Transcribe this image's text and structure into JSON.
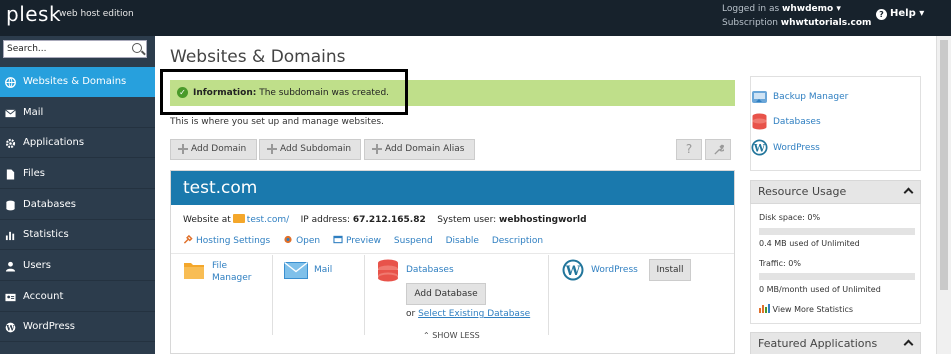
{
  "header": {
    "logo": "plesk",
    "edition": "web host edition",
    "logged_in_label": "Logged in as",
    "user": "whwdemo",
    "subscription_label": "Subscription",
    "subscription": "whwtutorials.com",
    "help": "Help"
  },
  "search": {
    "placeholder": "Search..."
  },
  "sidebar": {
    "items": [
      {
        "label": "Websites & Domains",
        "icon": "globe-icon",
        "active": true
      },
      {
        "label": "Mail",
        "icon": "envelope-icon"
      },
      {
        "label": "Applications",
        "icon": "gear-icon"
      },
      {
        "label": "Files",
        "icon": "file-icon"
      },
      {
        "label": "Databases",
        "icon": "database-icon"
      },
      {
        "label": "Statistics",
        "icon": "bar-chart-icon"
      },
      {
        "label": "Users",
        "icon": "user-icon"
      },
      {
        "label": "Account",
        "icon": "id-card-icon"
      },
      {
        "label": "WordPress",
        "icon": "wordpress-icon"
      }
    ]
  },
  "main": {
    "title": "Websites & Domains",
    "info_label": "Information:",
    "info_text": "The subdomain was created.",
    "intro": "This is where you set up and manage websites.",
    "toolbar": {
      "add_domain": "Add Domain",
      "add_subdomain": "Add Subdomain",
      "add_alias": "Add Domain Alias"
    }
  },
  "domain": {
    "name": "test.com",
    "website_at_label": "Website at",
    "website_link": "test.com/",
    "ip_label": "IP address:",
    "ip": "67.212.165.82",
    "user_label": "System user:",
    "user": "webhostingworld",
    "actions": [
      "Hosting Settings",
      "Open",
      "Preview",
      "Suspend",
      "Disable",
      "Description"
    ],
    "tools": {
      "file_manager_1": "File",
      "file_manager_2": "Manager",
      "mail": "Mail",
      "databases": "Databases",
      "add_database": "Add Database",
      "or": "or",
      "select_db": "Select Existing Database",
      "wordpress": "WordPress",
      "install": "Install"
    },
    "show_less": "SHOW LESS"
  },
  "quick_links": [
    "Backup Manager",
    "Databases",
    "WordPress"
  ],
  "resource_usage": {
    "title": "Resource Usage",
    "disk_label": "Disk space: 0%",
    "disk_used": "0.4 MB used of Unlimited",
    "disk_percent": 0,
    "traffic_label": "Traffic: 0%",
    "traffic_used": "0 MB/month used of Unlimited",
    "traffic_percent": 0,
    "more_stats": "View More Statistics"
  },
  "featured": {
    "title": "Featured Applications"
  },
  "colors": {
    "topbar": "#17222c",
    "sidebar": "#2c3c4c",
    "active": "#27a0dd",
    "domain_header": "#1a79ad",
    "info": "#bfdf8a",
    "link": "#2f7fc1"
  }
}
